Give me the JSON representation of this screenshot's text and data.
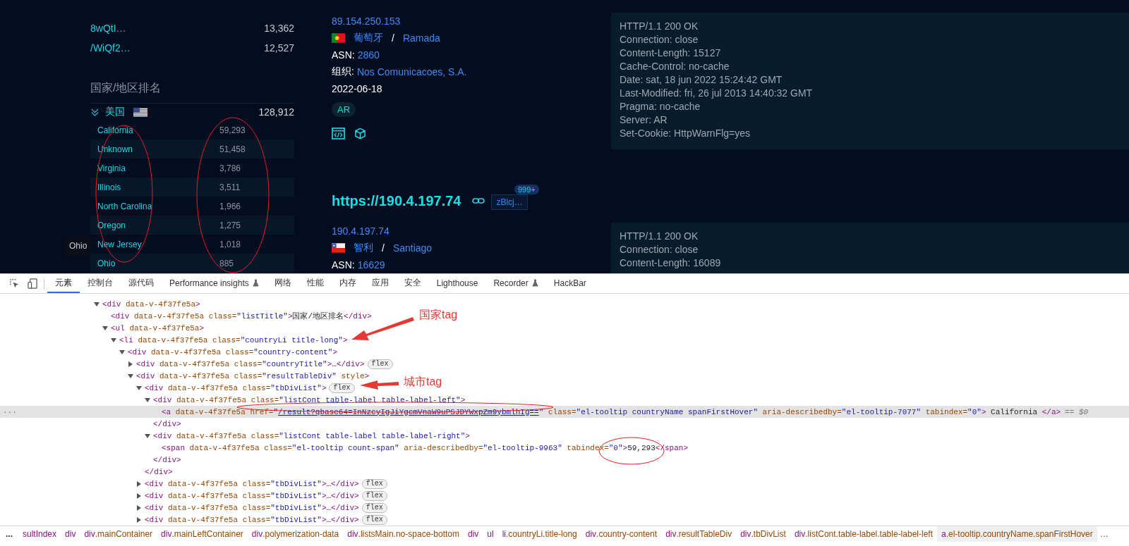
{
  "ranking_top": [
    {
      "name": "8wQtI…",
      "count": "13,362"
    },
    {
      "name": "/WiQf2…",
      "count": "12,527"
    }
  ],
  "ranking": {
    "title": "国家/地区排名",
    "country": {
      "name": "美国",
      "flag": {
        "kind": "us"
      },
      "count": "128,912",
      "expanded": true
    },
    "cities": [
      {
        "name": "California",
        "count": "59,293"
      },
      {
        "name": "Unknown",
        "count": "51,458"
      },
      {
        "name": "Virginia",
        "count": "3,786"
      },
      {
        "name": "Illinois",
        "count": "3,511"
      },
      {
        "name": "North Carolina",
        "count": "1,966"
      },
      {
        "name": "Oregon",
        "count": "1,275"
      },
      {
        "name": "New Jersey",
        "count": "1,018"
      },
      {
        "name": "Ohio",
        "count": "885"
      }
    ],
    "tooltip": "Ohio"
  },
  "results": [
    {
      "ip": "89.154.250.153",
      "flag": {
        "kind": "pt"
      },
      "country": "葡萄牙",
      "separator": "/",
      "city": "Ramada",
      "asn_label": "ASN:",
      "asn": "2860",
      "org_label": "组织:",
      "org": "Nos Comunicacoes, S.A.",
      "date": "2022-06-18",
      "tags": [
        "AR"
      ],
      "headers": [
        "HTTP/1.1 200 OK",
        "Connection: close",
        "Content-Length: 15127",
        "Cache-Control: no-cache",
        "Date: sat, 18 jun 2022 15:24:42 GMT",
        "Last-Modified: fri, 26 jul 2013 14:40:32 GMT",
        "Pragma: no-cache",
        "Server: AR",
        "Set-Cookie: HttpWarnFlg=yes"
      ]
    },
    {
      "url": "https://190.4.197.74",
      "product": "zBlcj…",
      "product_count": "999+",
      "ip": "190.4.197.74",
      "flag": {
        "kind": "cl"
      },
      "country": "智利",
      "separator": "/",
      "city": "Santiago",
      "asn_label": "ASN:",
      "asn": "16629",
      "headers": [
        "HTTP/1.1 200 OK",
        "Connection: close",
        "Content-Length: 16089"
      ]
    }
  ],
  "devtools": {
    "tabs": [
      {
        "label": "元素",
        "selected": true,
        "experimental": false
      },
      {
        "label": "控制台",
        "selected": false,
        "experimental": false
      },
      {
        "label": "源代码",
        "selected": false,
        "experimental": false
      },
      {
        "label": "Performance insights",
        "selected": false,
        "experimental": true
      },
      {
        "label": "网络",
        "selected": false,
        "experimental": false
      },
      {
        "label": "性能",
        "selected": false,
        "experimental": false
      },
      {
        "label": "内存",
        "selected": false,
        "experimental": false
      },
      {
        "label": "应用",
        "selected": false,
        "experimental": false
      },
      {
        "label": "安全",
        "selected": false,
        "experimental": false
      },
      {
        "label": "Lighthouse",
        "selected": false,
        "experimental": false
      },
      {
        "label": "Recorder",
        "selected": false,
        "experimental": true
      },
      {
        "label": "HackBar",
        "selected": false,
        "experimental": false
      }
    ],
    "selection_dots": "···",
    "selected_suffix": "== $0",
    "dom": [
      {
        "line": [
          {
            "kind": "tag",
            "text": "<div"
          },
          {
            "kind": "attr",
            "text": " data-v-4f37fe5a"
          },
          {
            "kind": "tag",
            "text": ">"
          }
        ],
        "expanded": true,
        "selected": false,
        "children": [
          {
            "line": [
              {
                "kind": "tag",
                "text": "<div"
              },
              {
                "kind": "attr",
                "text": " data-v-4f37fe5a"
              },
              {
                "kind": "attr",
                "text": " class="
              },
              {
                "kind": "val",
                "text": "\"listTitle\""
              },
              {
                "kind": "tag",
                "text": ">"
              },
              {
                "kind": "text",
                "text": "国家/地区排名"
              },
              {
                "kind": "tag",
                "text": "</div>"
              }
            ],
            "selected": false
          },
          {
            "line": [
              {
                "kind": "tag",
                "text": "<ul"
              },
              {
                "kind": "attr",
                "text": " data-v-4f37fe5a"
              },
              {
                "kind": "tag",
                "text": ">"
              }
            ],
            "expanded": true,
            "selected": false,
            "children": [
              {
                "line": [
                  {
                    "kind": "tag",
                    "text": "<li"
                  },
                  {
                    "kind": "attr",
                    "text": " data-v-4f37fe5a"
                  },
                  {
                    "kind": "attr",
                    "text": " class="
                  },
                  {
                    "kind": "val",
                    "text": "\"countryLi title-long\""
                  },
                  {
                    "kind": "tag",
                    "text": ">"
                  }
                ],
                "expanded": true,
                "selected": false,
                "children": [
                  {
                    "line": [
                      {
                        "kind": "tag",
                        "text": "<div"
                      },
                      {
                        "kind": "attr",
                        "text": " data-v-4f37fe5a"
                      },
                      {
                        "kind": "attr",
                        "text": " class="
                      },
                      {
                        "kind": "val",
                        "text": "\"country-content\""
                      },
                      {
                        "kind": "tag",
                        "text": ">"
                      }
                    ],
                    "expanded": true,
                    "selected": false,
                    "children": [
                      {
                        "line": [
                          {
                            "kind": "tag",
                            "text": "<div"
                          },
                          {
                            "kind": "attr",
                            "text": " data-v-4f37fe5a"
                          },
                          {
                            "kind": "attr",
                            "text": " class="
                          },
                          {
                            "kind": "val",
                            "text": "\"countryTitle\""
                          },
                          {
                            "kind": "tag",
                            "text": ">"
                          },
                          {
                            "kind": "text",
                            "text": "…"
                          },
                          {
                            "kind": "tag",
                            "text": "</div>"
                          }
                        ],
                        "expanded": false,
                        "selected": false,
                        "badge": "flex"
                      },
                      {
                        "line": [
                          {
                            "kind": "tag",
                            "text": "<div"
                          },
                          {
                            "kind": "attr",
                            "text": " data-v-4f37fe5a"
                          },
                          {
                            "kind": "attr",
                            "text": " class="
                          },
                          {
                            "kind": "val",
                            "text": "\"resultTableDiv\""
                          },
                          {
                            "kind": "attr",
                            "text": " style"
                          },
                          {
                            "kind": "tag",
                            "text": ">"
                          }
                        ],
                        "expanded": true,
                        "selected": false,
                        "children": [
                          {
                            "line": [
                              {
                                "kind": "tag",
                                "text": "<div"
                              },
                              {
                                "kind": "attr",
                                "text": " data-v-4f37fe5a"
                              },
                              {
                                "kind": "attr",
                                "text": " class="
                              },
                              {
                                "kind": "val",
                                "text": "\"tbDivList\""
                              },
                              {
                                "kind": "tag",
                                "text": ">"
                              }
                            ],
                            "expanded": true,
                            "selected": false,
                            "badge": "flex",
                            "end": [
                              {
                                "kind": "tag",
                                "text": "</div>"
                              }
                            ],
                            "children": [
                              {
                                "line": [
                                  {
                                    "kind": "tag",
                                    "text": "<div"
                                  },
                                  {
                                    "kind": "attr",
                                    "text": " data-v-4f37fe5a"
                                  },
                                  {
                                    "kind": "attr",
                                    "text": " class="
                                  },
                                  {
                                    "kind": "val",
                                    "text": "\"listCont table-label table-label-left\""
                                  },
                                  {
                                    "kind": "tag",
                                    "text": ">"
                                  }
                                ],
                                "expanded": true,
                                "selected": false,
                                "end": [
                                  {
                                    "kind": "tag",
                                    "text": "</div>"
                                  }
                                ],
                                "children": [
                                  {
                                    "line": [
                                      {
                                        "kind": "tag",
                                        "text": "<a"
                                      },
                                      {
                                        "kind": "attr",
                                        "text": " data-v-4f37fe5a"
                                      },
                                      {
                                        "kind": "attr",
                                        "text": " href="
                                      },
                                      {
                                        "kind": "val",
                                        "text": "\""
                                      },
                                      {
                                        "kind": "link",
                                        "text": "/result?qbase64=InNzcyIgJiYgcmVnaW9uPSJDYWxpZm9ybmlhIg=="
                                      },
                                      {
                                        "kind": "val",
                                        "text": "\""
                                      },
                                      {
                                        "kind": "attr",
                                        "text": " class="
                                      },
                                      {
                                        "kind": "val",
                                        "text": "\"el-tooltip countryName spanFirstHover\""
                                      },
                                      {
                                        "kind": "attr",
                                        "text": " aria-describedby="
                                      },
                                      {
                                        "kind": "val",
                                        "text": "\"el-tooltip-7077\""
                                      },
                                      {
                                        "kind": "attr",
                                        "text": " tabindex="
                                      },
                                      {
                                        "kind": "val",
                                        "text": "\"0\""
                                      },
                                      {
                                        "kind": "tag",
                                        "text": ">"
                                      },
                                      {
                                        "kind": "text",
                                        "text": " California "
                                      },
                                      {
                                        "kind": "tag",
                                        "text": "</a>"
                                      }
                                    ],
                                    "selected": true
                                  }
                                ]
                              },
                              {
                                "line": [
                                  {
                                    "kind": "tag",
                                    "text": "<div"
                                  },
                                  {
                                    "kind": "attr",
                                    "text": " data-v-4f37fe5a"
                                  },
                                  {
                                    "kind": "attr",
                                    "text": " class="
                                  },
                                  {
                                    "kind": "val",
                                    "text": "\"listCont table-label table-label-right\""
                                  },
                                  {
                                    "kind": "tag",
                                    "text": ">"
                                  }
                                ],
                                "expanded": true,
                                "selected": false,
                                "end": [
                                  {
                                    "kind": "tag",
                                    "text": "</div>"
                                  }
                                ],
                                "children": [
                                  {
                                    "line": [
                                      {
                                        "kind": "tag",
                                        "text": "<span"
                                      },
                                      {
                                        "kind": "attr",
                                        "text": " data-v-4f37fe5a"
                                      },
                                      {
                                        "kind": "attr",
                                        "text": " class="
                                      },
                                      {
                                        "kind": "val",
                                        "text": "\"el-tooltip count-span\""
                                      },
                                      {
                                        "kind": "attr",
                                        "text": " aria-describedby="
                                      },
                                      {
                                        "kind": "val",
                                        "text": "\"el-tooltip-9963\""
                                      },
                                      {
                                        "kind": "attr",
                                        "text": " tabindex="
                                      },
                                      {
                                        "kind": "val",
                                        "text": "\"0\""
                                      },
                                      {
                                        "kind": "tag",
                                        "text": ">"
                                      },
                                      {
                                        "kind": "text",
                                        "text": "59,293"
                                      },
                                      {
                                        "kind": "tag",
                                        "text": "</span>"
                                      }
                                    ],
                                    "selected": false
                                  }
                                ]
                              }
                            ]
                          },
                          {
                            "line": [
                              {
                                "kind": "tag",
                                "text": "<div"
                              },
                              {
                                "kind": "attr",
                                "text": " data-v-4f37fe5a"
                              },
                              {
                                "kind": "attr",
                                "text": " class="
                              },
                              {
                                "kind": "val",
                                "text": "\"tbDivList\""
                              },
                              {
                                "kind": "tag",
                                "text": ">"
                              },
                              {
                                "kind": "text",
                                "text": "…"
                              },
                              {
                                "kind": "tag",
                                "text": "</div>"
                              }
                            ],
                            "expanded": false,
                            "selected": false,
                            "badge": "flex"
                          },
                          {
                            "line": [
                              {
                                "kind": "tag",
                                "text": "<div"
                              },
                              {
                                "kind": "attr",
                                "text": " data-v-4f37fe5a"
                              },
                              {
                                "kind": "attr",
                                "text": " class="
                              },
                              {
                                "kind": "val",
                                "text": "\"tbDivList\""
                              },
                              {
                                "kind": "tag",
                                "text": ">"
                              },
                              {
                                "kind": "text",
                                "text": "…"
                              },
                              {
                                "kind": "tag",
                                "text": "</div>"
                              }
                            ],
                            "expanded": false,
                            "selected": false,
                            "badge": "flex"
                          },
                          {
                            "line": [
                              {
                                "kind": "tag",
                                "text": "<div"
                              },
                              {
                                "kind": "attr",
                                "text": " data-v-4f37fe5a"
                              },
                              {
                                "kind": "attr",
                                "text": " class="
                              },
                              {
                                "kind": "val",
                                "text": "\"tbDivList\""
                              },
                              {
                                "kind": "tag",
                                "text": ">"
                              },
                              {
                                "kind": "text",
                                "text": "…"
                              },
                              {
                                "kind": "tag",
                                "text": "</div>"
                              }
                            ],
                            "expanded": false,
                            "selected": false,
                            "badge": "flex"
                          },
                          {
                            "line": [
                              {
                                "kind": "tag",
                                "text": "<div"
                              },
                              {
                                "kind": "attr",
                                "text": " data-v-4f37fe5a"
                              },
                              {
                                "kind": "attr",
                                "text": " class="
                              },
                              {
                                "kind": "val",
                                "text": "\"tbDivList\""
                              },
                              {
                                "kind": "tag",
                                "text": ">"
                              },
                              {
                                "kind": "text",
                                "text": "…"
                              },
                              {
                                "kind": "tag",
                                "text": "</div>"
                              }
                            ],
                            "expanded": false,
                            "selected": false,
                            "badge": "flex"
                          }
                        ]
                      }
                    ]
                  }
                ]
              }
            ]
          }
        ]
      }
    ],
    "breadcrumb_prefix": "...",
    "breadcrumb": [
      {
        "text": "sultIndex",
        "selected": false
      },
      {
        "text": "div",
        "selected": false
      },
      {
        "text": "div.mainContainer",
        "selected": false
      },
      {
        "text": "div.mainLeftContainer",
        "selected": false
      },
      {
        "text": "div.polymerization-data",
        "selected": false
      },
      {
        "text": "div.listsMain.no-space-bottom",
        "selected": false
      },
      {
        "text": "div",
        "selected": false
      },
      {
        "text": "ul",
        "selected": false
      },
      {
        "text": "li.countryLi.title-long",
        "selected": false
      },
      {
        "text": "div.country-content",
        "selected": false
      },
      {
        "text": "div.resultTableDiv",
        "selected": false
      },
      {
        "text": "div.tbDivList",
        "selected": false
      },
      {
        "text": "div.listCont.table-label.table-label-left",
        "selected": false
      },
      {
        "text": "a.el-tooltip.countryName.spanFirstHover",
        "selected": true
      }
    ],
    "breadcrumb_suffix": "…"
  },
  "annotations": [
    {
      "text": "国家tag"
    },
    {
      "text": "城市tag"
    }
  ]
}
